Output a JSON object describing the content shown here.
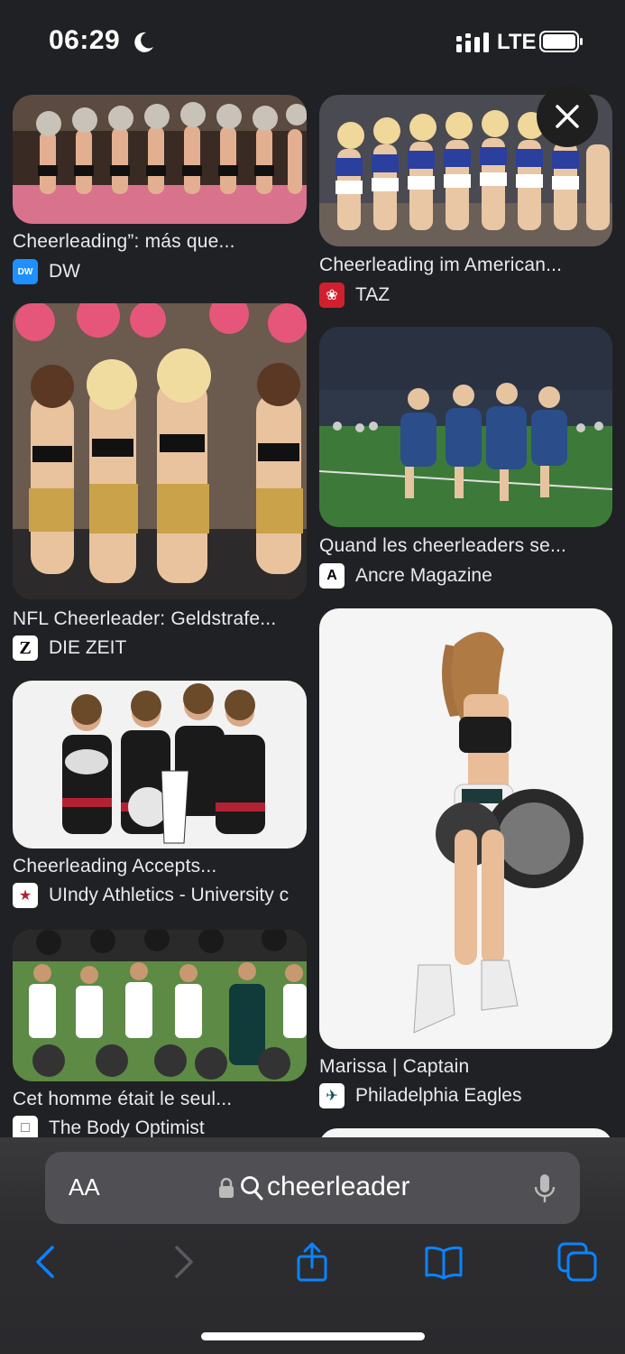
{
  "status": {
    "time": "06:29",
    "network": "LTE"
  },
  "results": [
    {
      "title": "Cheerleading”: más que...",
      "source": "DW",
      "favicon_text": "DW",
      "favicon_color": "#1e90ff"
    },
    {
      "title": "Cheerleading im American...",
      "source": "TAZ",
      "favicon_text": "❀",
      "favicon_color": "#d0202f"
    },
    {
      "title": "NFL Cheerleader: Geldstrafe...",
      "source": "DIE ZEIT",
      "favicon_text": "Z",
      "favicon_color": "#ffffff"
    },
    {
      "title": "Quand les cheerleaders se...",
      "source": "Ancre Magazine",
      "favicon_text": "A",
      "favicon_color": "#ffffff"
    },
    {
      "title": "Cheerleading Accepts...",
      "source": "UIndy Athletics - University c",
      "favicon_text": "★",
      "favicon_color": "#ffffff"
    },
    {
      "title": "Marissa | Captain",
      "source": "Philadelphia Eagles",
      "favicon_text": "✈",
      "favicon_color": "#ffffff"
    },
    {
      "title": "Cet homme était le seul...",
      "source": "The Body Optimist",
      "favicon_text": "□",
      "favicon_color": "#ffffff"
    }
  ],
  "browser": {
    "aa_label": "AA",
    "query": "cheerleader"
  },
  "colors": {
    "background": "#202124",
    "accent": "#0a84ff"
  },
  "icons": [
    "moon-icon",
    "signal-icon",
    "battery-icon",
    "close-icon",
    "lock-icon",
    "search-icon",
    "mic-icon",
    "back-icon",
    "forward-icon",
    "share-icon",
    "bookmarks-icon",
    "tabs-icon"
  ]
}
